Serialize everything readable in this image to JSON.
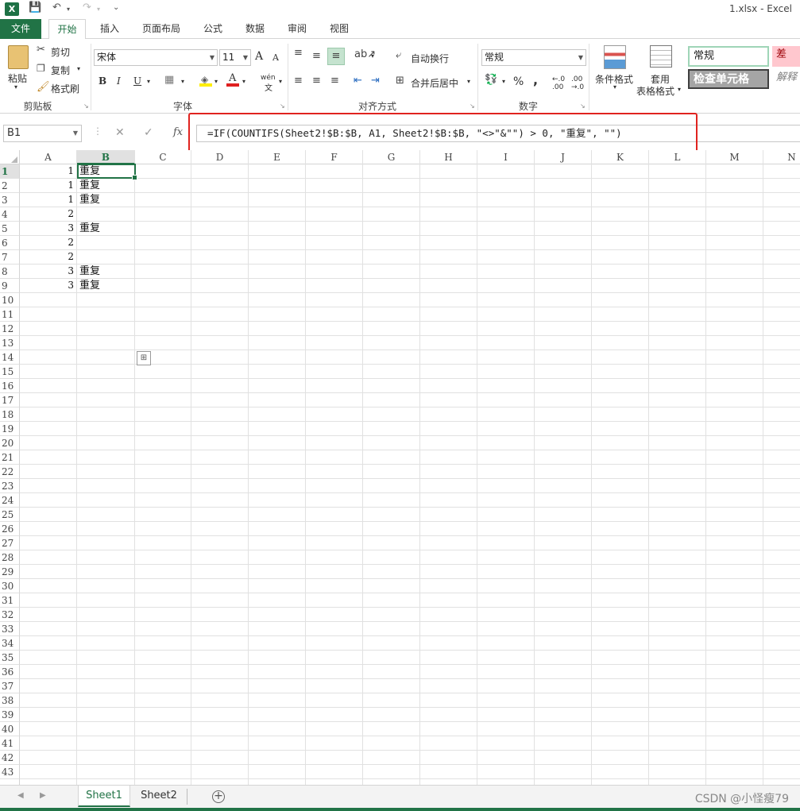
{
  "window": {
    "title": "1.xlsx - Excel",
    "app_icon": "X"
  },
  "quick_access": {
    "save_icon": "💾",
    "undo_icon": "↶",
    "redo_icon": "↷",
    "more_icon": "⌄"
  },
  "tabs": {
    "file": "文件",
    "items": [
      "开始",
      "插入",
      "页面布局",
      "公式",
      "数据",
      "审阅",
      "视图"
    ],
    "active": "开始"
  },
  "ribbon": {
    "clipboard": {
      "paste": "粘贴",
      "cut": "剪切",
      "copy": "复制",
      "format_painter": "格式刷",
      "label": "剪贴板"
    },
    "font": {
      "name": "宋体",
      "size": "11",
      "grow": "A",
      "shrink": "A",
      "bold": "B",
      "italic": "I",
      "underline": "U",
      "phonetic": "wén",
      "label": "字体"
    },
    "alignment": {
      "wrap": "自动换行",
      "merge": "合并后居中",
      "label": "对齐方式"
    },
    "number": {
      "format": "常规",
      "percent": "%",
      "comma": ",",
      "label": "数字"
    },
    "styles": {
      "conditional": "条件格式",
      "table_format_1": "套用",
      "table_format_2": "表格格式",
      "normal": "常规",
      "bad": "差",
      "check_cell": "检查单元格",
      "explain": "解释"
    }
  },
  "formula_bar": {
    "name_box": "B1",
    "cancel": "✕",
    "enter": "✓",
    "fx": "fx",
    "formula": "=IF(COUNTIFS(Sheet2!$B:$B, A1, Sheet2!$B:$B, \"<>\"&\"\") > 0, \"重复\", \"\")"
  },
  "grid": {
    "columns": [
      "A",
      "B",
      "C",
      "D",
      "E",
      "F",
      "G",
      "H",
      "I",
      "J",
      "K",
      "L",
      "M",
      "N"
    ],
    "selected_column": "B",
    "selected_row": 1,
    "row_count": 43,
    "cells": {
      "A": [
        "1",
        "1",
        "1",
        "2",
        "3",
        "2",
        "2",
        "3",
        "3"
      ],
      "B": [
        "重复",
        "重复",
        "重复",
        "",
        "重复",
        "",
        "",
        "重复",
        "重复"
      ]
    }
  },
  "sheets": {
    "tabs": [
      "Sheet1",
      "Sheet2"
    ],
    "active": "Sheet1",
    "add": "+"
  },
  "watermark": "CSDN @小怪瘦79",
  "colors": {
    "excel_green": "#217346",
    "highlight_red": "#e0231f",
    "bad_bg": "#ffc7ce",
    "bad_text": "#9c0006",
    "check_bg": "#a5a5a5"
  }
}
